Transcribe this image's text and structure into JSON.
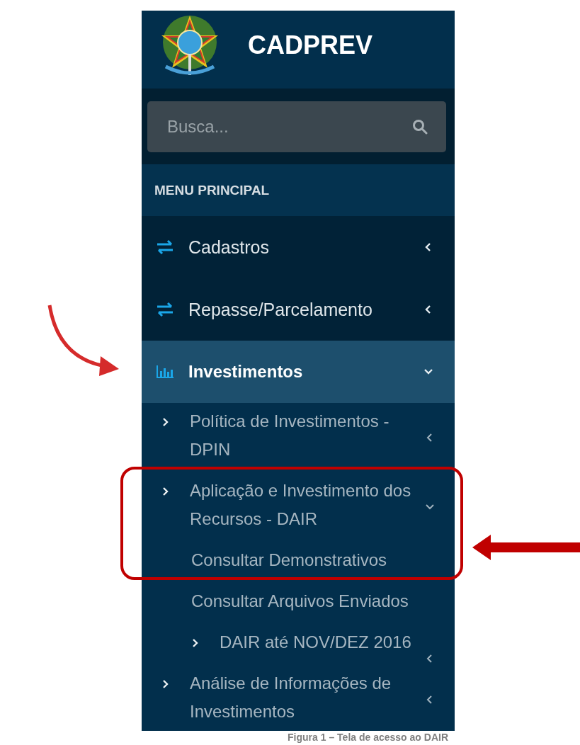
{
  "header": {
    "title": "CADPREV"
  },
  "search": {
    "placeholder": "Busca..."
  },
  "menu_heading": "MENU PRINCIPAL",
  "menu": [
    {
      "label": "Cadastros",
      "kind": "exchange",
      "selected": false,
      "expanded": false
    },
    {
      "label": "Repasse/Parcelamento",
      "kind": "exchange",
      "selected": false,
      "expanded": false
    },
    {
      "label": "Investimentos",
      "kind": "chart",
      "selected": true,
      "expanded": true,
      "children": [
        {
          "label": "Política de Investimentos - DPIN",
          "kind": "group",
          "expanded": false
        },
        {
          "label": "Aplicação e Investimento dos Recursos - DAIR",
          "kind": "group",
          "expanded": true,
          "children": [
            {
              "label": "Consultar Demonstrativos",
              "kind": "link"
            },
            {
              "label": "Consultar Arquivos Enviados",
              "kind": "link"
            },
            {
              "label": "DAIR até NOV/DEZ 2016",
              "kind": "group",
              "expanded": false
            }
          ]
        },
        {
          "label": "Análise de Informações de Investimentos",
          "kind": "group",
          "expanded": false
        }
      ]
    }
  ],
  "caption": "Figura 1 – Tela de acesso ao DAIR"
}
